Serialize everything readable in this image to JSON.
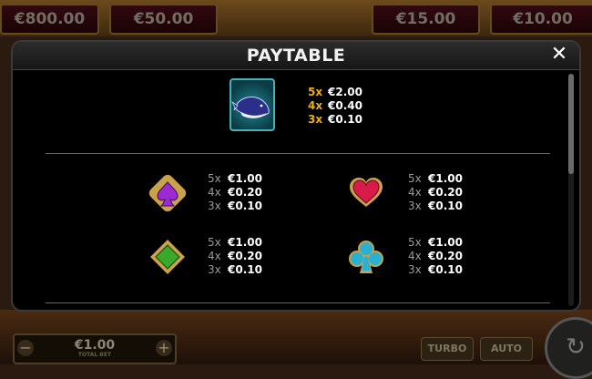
{
  "background": {
    "jackpots": [
      "€800.00",
      "€50.00",
      "€15.00",
      "€10.00"
    ],
    "bet_value": "€1.00",
    "bet_label": "TOTAL BET",
    "minus_label": "−",
    "plus_label": "+",
    "turbo_label": "TURBO",
    "auto_label": "AUTO",
    "spin_icon": "↻"
  },
  "modal": {
    "title": "PAYTABLE",
    "close_label": "✕"
  },
  "paytable": {
    "whale": {
      "icon": "whale-icon",
      "pays": [
        {
          "mult": "5x",
          "amount": "€2.00"
        },
        {
          "mult": "4x",
          "amount": "€0.40"
        },
        {
          "mult": "3x",
          "amount": "€0.10"
        }
      ]
    },
    "spade": {
      "icon": "spade-icon",
      "color": "#9b2ad4",
      "pays": [
        {
          "mult": "5x",
          "amount": "€1.00"
        },
        {
          "mult": "4x",
          "amount": "€0.20"
        },
        {
          "mult": "3x",
          "amount": "€0.10"
        }
      ]
    },
    "heart": {
      "icon": "heart-icon",
      "color": "#d81b48",
      "pays": [
        {
          "mult": "5x",
          "amount": "€1.00"
        },
        {
          "mult": "4x",
          "amount": "€0.20"
        },
        {
          "mult": "3x",
          "amount": "€0.10"
        }
      ]
    },
    "diamond": {
      "icon": "diamond-icon",
      "color": "#3aa82a",
      "pays": [
        {
          "mult": "5x",
          "amount": "€1.00"
        },
        {
          "mult": "4x",
          "amount": "€0.20"
        },
        {
          "mult": "3x",
          "amount": "€0.10"
        }
      ]
    },
    "club": {
      "icon": "club-icon",
      "color": "#2ab0d0",
      "pays": [
        {
          "mult": "5x",
          "amount": "€1.00"
        },
        {
          "mult": "4x",
          "amount": "€0.20"
        },
        {
          "mult": "3x",
          "amount": "€0.10"
        }
      ]
    }
  }
}
